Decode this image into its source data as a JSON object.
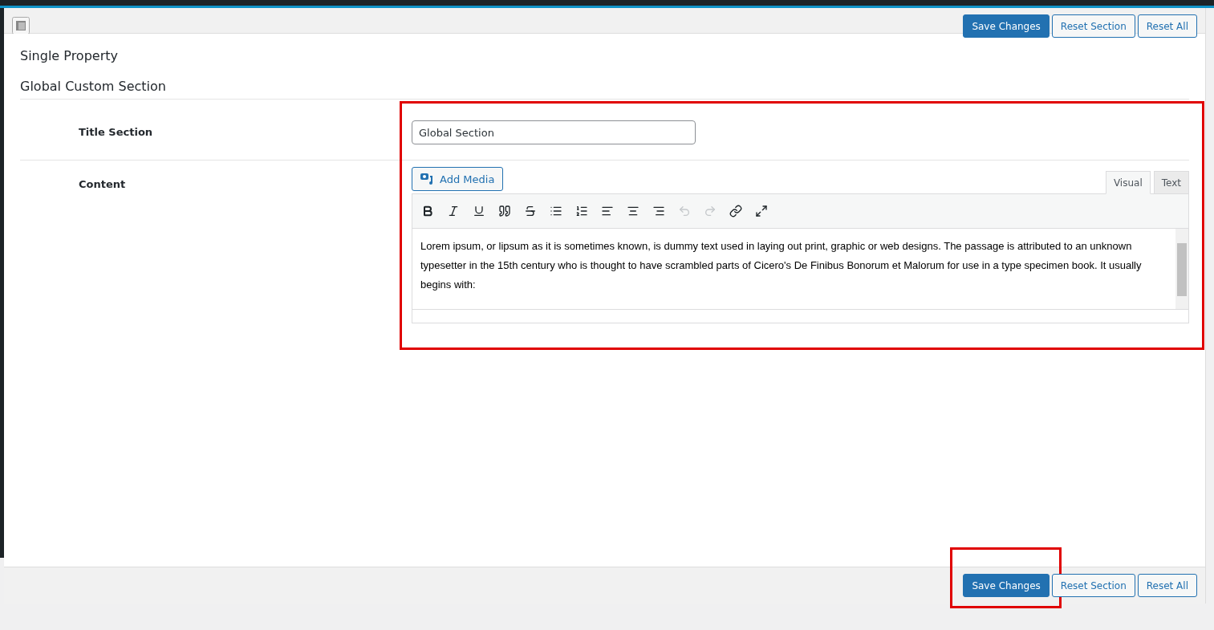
{
  "header_buttons": [
    {
      "label": "Save Changes",
      "kind": "primary"
    },
    {
      "label": "Reset Section",
      "kind": "secondary"
    },
    {
      "label": "Reset All",
      "kind": "secondary"
    }
  ],
  "page_title": "Single Property",
  "section_title": "Global Custom Section",
  "fields": [
    {
      "label": "Title Section",
      "kind": "text",
      "value": "Global Section"
    },
    {
      "label": "Content",
      "kind": "editor"
    }
  ],
  "editor": {
    "add_media": "Add Media",
    "tabs": [
      {
        "label": "Visual",
        "selected": true
      },
      {
        "label": "Text",
        "selected": false
      }
    ],
    "toolbar": [
      {
        "kind": "bold",
        "disabled": false
      },
      {
        "kind": "italic",
        "disabled": false
      },
      {
        "kind": "underline",
        "disabled": false
      },
      {
        "kind": "quote",
        "disabled": false
      },
      {
        "kind": "strike",
        "disabled": false
      },
      {
        "kind": "bullets",
        "disabled": false
      },
      {
        "kind": "numbers",
        "disabled": false
      },
      {
        "kind": "align-left",
        "disabled": false
      },
      {
        "kind": "align-center",
        "disabled": false
      },
      {
        "kind": "align-right",
        "disabled": false
      },
      {
        "kind": "undo",
        "disabled": true
      },
      {
        "kind": "redo",
        "disabled": true
      },
      {
        "kind": "link",
        "disabled": false
      },
      {
        "kind": "fullscreen",
        "disabled": false
      }
    ],
    "content": "Lorem ipsum, or lipsum as it is sometimes known, is dummy text used in laying out print, graphic or web designs. The passage is attributed to an unknown typesetter in the 15th century who is thought to have scrambled parts of Cicero's De Finibus Bonorum et Malorum for use in a type specimen book. It usually begins with:"
  },
  "footer_buttons": [
    {
      "label": "Save Changes",
      "kind": "primary"
    },
    {
      "label": "Reset Section",
      "kind": "secondary"
    },
    {
      "label": "Reset All",
      "kind": "secondary"
    }
  ]
}
